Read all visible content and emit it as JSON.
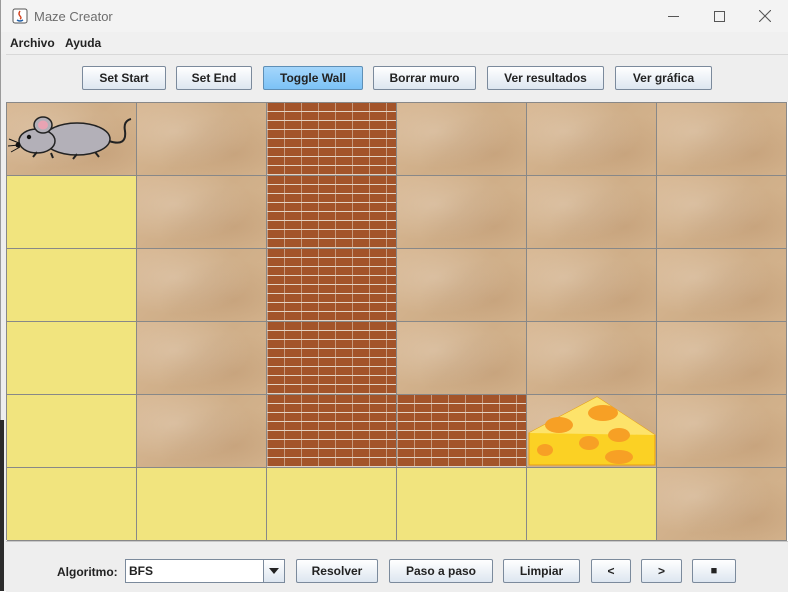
{
  "window": {
    "title": "Maze Creator"
  },
  "menu": {
    "items": [
      "Archivo",
      "Ayuda"
    ]
  },
  "toolbar": {
    "set_start": "Set Start",
    "set_end": "Set End",
    "toggle_wall": "Toggle Wall",
    "borrar_muro": "Borrar muro",
    "ver_resultados": "Ver resultados",
    "ver_grafica": "Ver gráfica",
    "active_button": "Toggle Wall"
  },
  "maze": {
    "rows": 6,
    "cols": 6,
    "legend": {
      "S": "start",
      "E": "end",
      "W": "wall",
      "P": "path",
      ".": "empty"
    },
    "cells": [
      [
        "S",
        ".",
        "W",
        ".",
        ".",
        "."
      ],
      [
        "P",
        ".",
        "W",
        ".",
        ".",
        "."
      ],
      [
        "P",
        ".",
        "W",
        ".",
        ".",
        "."
      ],
      [
        "P",
        ".",
        "W",
        ".",
        ".",
        "."
      ],
      [
        "P",
        ".",
        "W",
        "W",
        "E",
        "."
      ],
      [
        "P",
        "P",
        "P",
        "P",
        "P",
        "."
      ]
    ],
    "start_icon": "mouse-icon",
    "end_icon": "cheese-icon",
    "colors": {
      "path": "#f1e47e",
      "wall": "#a3542a",
      "floor": "#d4b48e",
      "grid_line": "#888888"
    }
  },
  "controls": {
    "algorithm_label": "Algoritmo:",
    "algorithm_value": "BFS",
    "resolver": "Resolver",
    "paso_a_paso": "Paso a paso",
    "limpiar": "Limpiar",
    "prev": "<",
    "next": ">",
    "stop": "■"
  }
}
